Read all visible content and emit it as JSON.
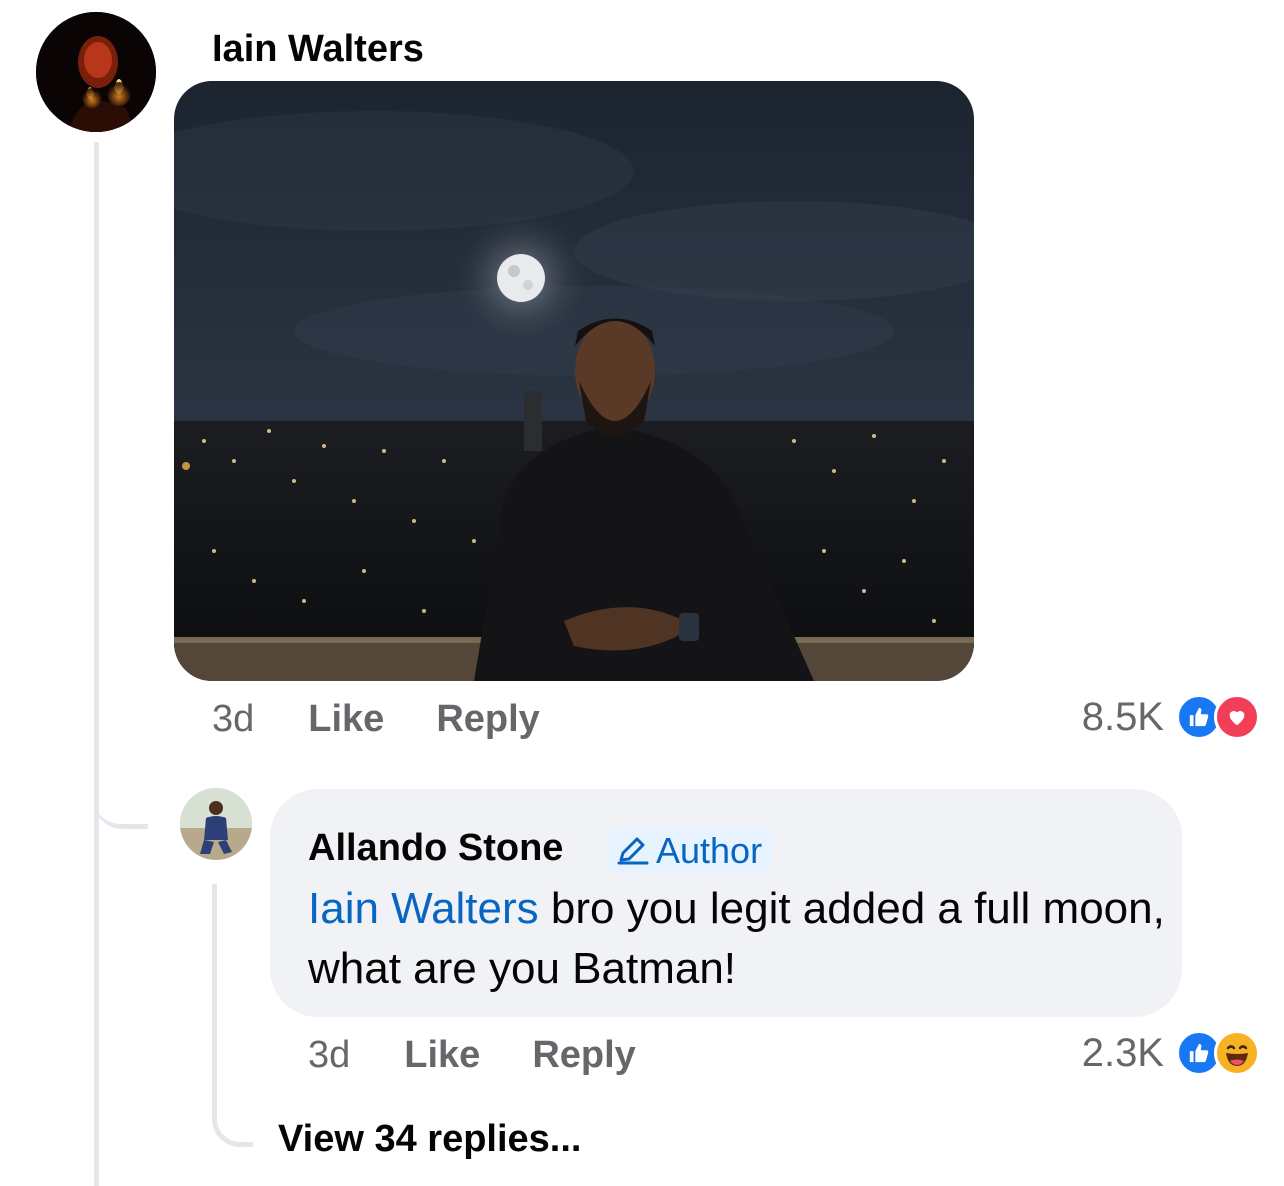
{
  "comment": {
    "author": "Iain Walters",
    "time": "3d",
    "like_label": "Like",
    "reply_label": "Reply",
    "reaction_count": "8.5K",
    "reactions": [
      "like-icon",
      "love-icon"
    ],
    "colors": {
      "like": "#1877f2",
      "love": "#f33e58"
    }
  },
  "reply": {
    "author": "Allando Stone",
    "badge": "Author",
    "badge_icon": "pencil-icon",
    "mention": "Iain Walters",
    "text": " bro you legit added a full moon, what are you Batman!",
    "time": "3d",
    "like_label": "Like",
    "reply_label": "Reply",
    "reaction_count": "2.3K",
    "reactions": [
      "like-icon",
      "haha-icon"
    ],
    "colors": {
      "like": "#1877f2",
      "haha": "#f7b125",
      "bubble": "#f0f2f5",
      "link": "#0866c2"
    }
  },
  "view_replies": "View 34 replies..."
}
